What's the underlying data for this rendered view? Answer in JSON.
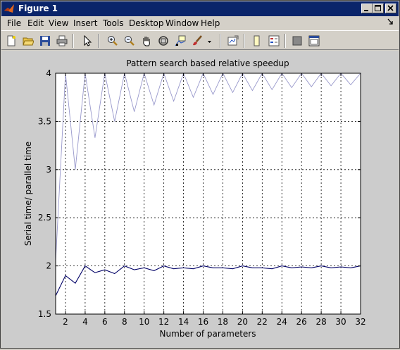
{
  "window": {
    "title": "Figure 1",
    "title_bar_color": "#0a246a"
  },
  "menu": [
    {
      "label": "File"
    },
    {
      "label": "Edit"
    },
    {
      "label": "View"
    },
    {
      "label": "Insert"
    },
    {
      "label": "Tools"
    },
    {
      "label": "Desktop"
    },
    {
      "label": "Window"
    },
    {
      "label": "Help"
    }
  ],
  "toolbar_icons": [
    "new-figure-icon",
    "open-file-icon",
    "save-icon",
    "print-icon",
    "select-arrow-icon",
    "zoom-in-icon",
    "zoom-out-icon",
    "pan-hand-icon",
    "rotate-3d-icon",
    "data-cursor-icon",
    "brush-icon",
    "link-plot-icon",
    "colorbar-icon",
    "legend-icon",
    "hide-plot-tools-icon",
    "show-plot-tools-icon"
  ],
  "chart_data": {
    "type": "line",
    "title": "Pattern search based relative speedup",
    "xlabel": "Number of parameters",
    "ylabel": "Serial time/ parallel time",
    "xlim": [
      1,
      32
    ],
    "ylim": [
      1.5,
      4
    ],
    "xticks": [
      2,
      4,
      6,
      8,
      10,
      12,
      14,
      16,
      18,
      20,
      22,
      24,
      26,
      28,
      30,
      32
    ],
    "yticks": [
      1.5,
      2,
      2.5,
      3,
      3.5,
      4
    ],
    "ytick_labels": [
      "1.5",
      "2",
      "2.5",
      "3",
      "3.5",
      "4"
    ],
    "grid": true,
    "grid_style": "dotted",
    "series": [
      {
        "color": "#9999cc",
        "x": [
          1,
          2,
          3,
          4,
          5,
          6,
          7,
          8,
          9,
          10,
          11,
          12,
          13,
          14,
          15,
          16,
          17,
          18,
          19,
          20,
          21,
          22,
          23,
          24,
          25,
          26,
          27,
          28,
          29,
          30,
          31,
          32
        ],
        "y": [
          2.05,
          4.0,
          3.0,
          4.0,
          3.33,
          4.0,
          3.5,
          4.0,
          3.6,
          4.0,
          3.67,
          4.0,
          3.71,
          4.0,
          3.75,
          4.0,
          3.78,
          4.0,
          3.8,
          4.0,
          3.82,
          4.0,
          3.83,
          4.0,
          3.85,
          4.0,
          3.86,
          4.0,
          3.87,
          4.0,
          3.88,
          4.0
        ]
      },
      {
        "color": "#000066",
        "x": [
          1,
          2,
          3,
          4,
          5,
          6,
          7,
          8,
          9,
          10,
          11,
          12,
          13,
          14,
          15,
          16,
          17,
          18,
          19,
          20,
          21,
          22,
          23,
          24,
          25,
          26,
          27,
          28,
          29,
          30,
          31,
          32
        ],
        "y": [
          1.69,
          1.9,
          1.82,
          2.0,
          1.93,
          1.96,
          1.92,
          2.0,
          1.96,
          1.98,
          1.95,
          2.0,
          1.97,
          1.98,
          1.97,
          2.0,
          1.98,
          1.98,
          1.97,
          2.0,
          1.98,
          1.98,
          1.97,
          2.0,
          1.98,
          1.99,
          1.98,
          2.0,
          1.98,
          1.99,
          1.98,
          2.0
        ]
      }
    ]
  }
}
